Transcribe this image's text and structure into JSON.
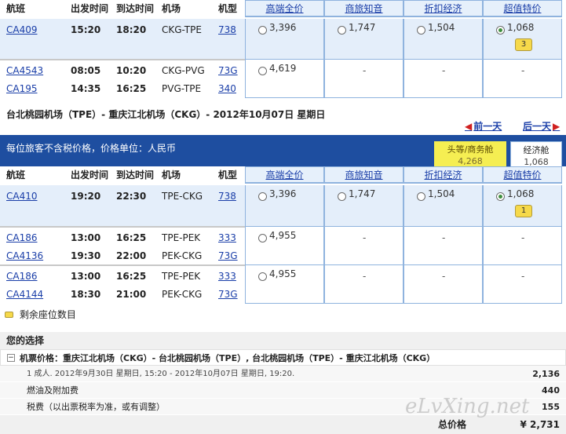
{
  "columns": {
    "flight": "航班",
    "depart": "出发时间",
    "arrive": "到达时间",
    "airport": "机场",
    "aircraft": "机型"
  },
  "fare_headers": [
    "高端全价",
    "商旅知音",
    "折扣经济",
    "超值特价"
  ],
  "outbound": {
    "groups": [
      {
        "legs": [
          {
            "flight": "CA409",
            "depart": "15:20",
            "arrive": "18:20",
            "airport": "CKG-TPE",
            "aircraft": "738"
          }
        ],
        "fares": [
          "3,396",
          "1,747",
          "1,504",
          "1,068"
        ],
        "selected_fare": 3,
        "seat_badge": "3"
      },
      {
        "legs": [
          {
            "flight": "CA4543",
            "depart": "08:05",
            "arrive": "10:20",
            "airport": "CKG-PVG",
            "aircraft": "73G"
          },
          {
            "flight": "CA195",
            "depart": "14:35",
            "arrive": "16:25",
            "airport": "PVG-TPE",
            "aircraft": "340"
          }
        ],
        "fares": [
          "4,619",
          "-",
          "-",
          "-"
        ]
      }
    ]
  },
  "return_header": {
    "route": "台北桃园机场（TPE）- 重庆江北机场（CKG）- 2012年10月07日  星期日",
    "prev_day": "前一天",
    "next_day": "后一天"
  },
  "price_note": "每位旅客不含税价格，价格单位：人民币",
  "cabin_tabs": [
    {
      "label": "头等/商务舱",
      "price": "4,268",
      "active": false
    },
    {
      "label": "经济舱",
      "price": "1,068",
      "active": true
    }
  ],
  "inbound": {
    "groups": [
      {
        "legs": [
          {
            "flight": "CA410",
            "depart": "19:20",
            "arrive": "22:30",
            "airport": "TPE-CKG",
            "aircraft": "738"
          }
        ],
        "fares": [
          "3,396",
          "1,747",
          "1,504",
          "1,068"
        ],
        "selected_fare": 3,
        "seat_badge": "1"
      },
      {
        "legs": [
          {
            "flight": "CA186",
            "depart": "13:00",
            "arrive": "16:25",
            "airport": "TPE-PEK",
            "aircraft": "333"
          },
          {
            "flight": "CA4136",
            "depart": "19:30",
            "arrive": "22:00",
            "airport": "PEK-CKG",
            "aircraft": "73G"
          }
        ],
        "fares": [
          "4,955",
          "-",
          "-",
          "-"
        ]
      },
      {
        "legs": [
          {
            "flight": "CA186",
            "depart": "13:00",
            "arrive": "16:25",
            "airport": "TPE-PEK",
            "aircraft": "333"
          },
          {
            "flight": "CA4144",
            "depart": "18:30",
            "arrive": "21:00",
            "airport": "PEK-CKG",
            "aircraft": "73G"
          }
        ],
        "fares": [
          "4,955",
          "-",
          "-",
          "-"
        ]
      }
    ]
  },
  "legend": {
    "label": "剩余座位数目"
  },
  "summary": {
    "title": "您的选择",
    "ticket_label": "机票价格：重庆江北机场（CKG）- 台北桃园机场（TPE）, 台北桃园机场（TPE）- 重庆江北机场（CKG）",
    "pax_line": "1 成人. 2012年9月30日  星期日, 15:20 - 2012年10月07日  星期日, 19:20.",
    "pax_amount": "2,136",
    "fuel_label": "燃油及附加费",
    "fuel_amount": "440",
    "tax_label": "税费（以出票税率为准，或有调整）",
    "tax_amount": "155",
    "total_label": "总价格",
    "total_amount": "¥ 2,731"
  },
  "watermark": "eLvXing.net",
  "colors": {
    "blue_bar": "#1e4ea0",
    "selected_row": "#e4eefa",
    "link": "#1a3ea8",
    "badge": "#f6d94a",
    "tab_yellow": "#f5ee52"
  }
}
